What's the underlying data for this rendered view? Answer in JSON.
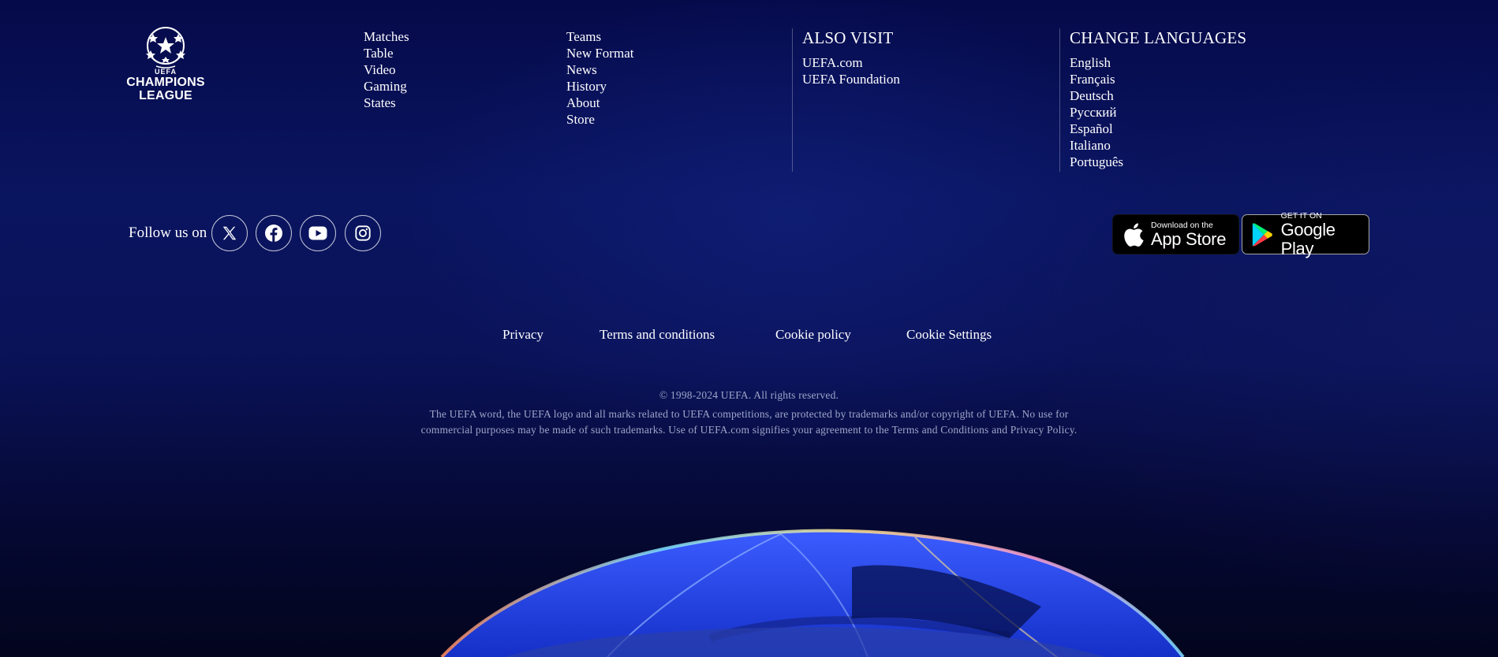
{
  "brand": {
    "logo_line1": "CHAMPIONS",
    "logo_line2": "LEAGUE",
    "logo_top": "UEFA"
  },
  "nav": {
    "col1": [
      "Matches",
      "Table",
      "Video",
      "Gaming",
      "States"
    ],
    "col2": [
      "Teams",
      "New Format",
      "News",
      "History",
      "About",
      "Store"
    ]
  },
  "also_visit": {
    "heading": "ALSO VISIT",
    "links": [
      "UEFA.com",
      "UEFA Foundation"
    ]
  },
  "languages": {
    "heading": "CHANGE LANGUAGES",
    "items": [
      "English",
      "Français",
      "Deutsch",
      "Русский",
      "Español",
      "Italiano",
      "Português"
    ]
  },
  "social": {
    "follow_label": "Follow us on",
    "icons": [
      "x-icon",
      "facebook-icon",
      "youtube-icon",
      "instagram-icon"
    ]
  },
  "apps": {
    "apple_small": "Download on the",
    "apple_big": "App Store",
    "google_small": "GET IT ON",
    "google_big": "Google Play"
  },
  "legal": {
    "privacy": "Privacy",
    "terms": "Terms and conditions",
    "cookie_policy": "Cookie policy",
    "cookie_settings": "Cookie Settings"
  },
  "copyright": {
    "line1": "© 1998-2024 UEFA. All rights reserved.",
    "line2": "The UEFA word, the UEFA logo and all marks related to UEFA competitions, are protected by trademarks and/or copyright of UEFA. No use for",
    "line3": "commercial purposes may be made of such trademarks. Use of UEFA.com signifies your agreement to the Terms and Conditions and Privacy Policy."
  },
  "colors": {
    "background_top": "#050a4a",
    "background_bottom": "#03051e",
    "muted_text": "#9ea6c8",
    "stadium_blue": "#1f3fd6"
  }
}
